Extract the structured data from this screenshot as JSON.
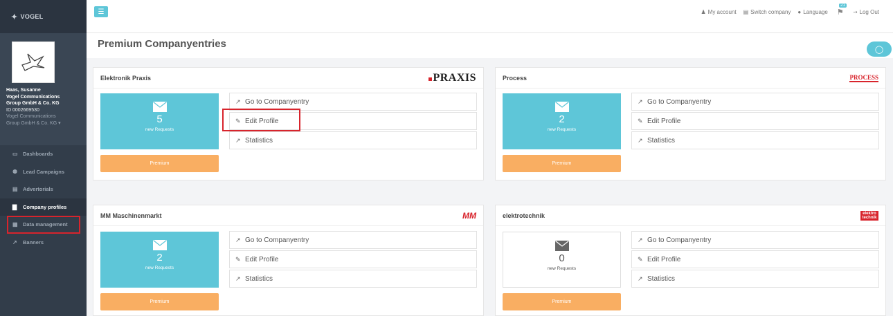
{
  "brand": {
    "logo_text": "VOGEL"
  },
  "user": {
    "name": "Haas, Susanne",
    "company_line1": "Vogel Communications",
    "company_line2": "Group GmbH & Co. KG",
    "id": "ID 0002669530",
    "sub_line1": "Vogel Communications",
    "sub_line2": "Group GmbH & Co. KG ▾"
  },
  "nav": [
    {
      "label": "Dashboards",
      "icon": "monitor-icon",
      "glyph": "▭"
    },
    {
      "label": "Lead Campaigns",
      "icon": "users-icon",
      "glyph": "⚉"
    },
    {
      "label": "Advertorials",
      "icon": "newspaper-icon",
      "glyph": "▤"
    },
    {
      "label": "Company profiles",
      "icon": "building-icon",
      "glyph": "▇",
      "active": true
    },
    {
      "label": "Data management",
      "icon": "grid-icon",
      "glyph": "▦",
      "highlight": true
    },
    {
      "label": "Banners",
      "icon": "chart-icon",
      "glyph": "↗"
    }
  ],
  "topbar": {
    "my_account": "My account",
    "switch_company": "Switch company",
    "language": "Language",
    "notif_count": "21",
    "logout": "Log Out"
  },
  "page": {
    "title": "Premium Companyentries"
  },
  "actions": {
    "go": "Go to Companyentry",
    "edit": "Edit Profile",
    "stats": "Statistics",
    "premium": "Premium",
    "new_requests": "new Requests"
  },
  "cards": [
    {
      "title": "Elektronik Praxis",
      "brand": "PRAXIS",
      "count": "5"
    },
    {
      "title": "Process",
      "brand": "PROCESS",
      "count": "2"
    },
    {
      "title": "MM Maschinenmarkt",
      "brand": "MM",
      "count": "2"
    },
    {
      "title": "elektrotechnik",
      "brand": "elektro technik",
      "count": "0"
    }
  ],
  "colors": {
    "accent": "#5ec6d8",
    "premium": "#f9ae62",
    "highlight": "#d8242c",
    "sidebar": "#323d4a"
  }
}
